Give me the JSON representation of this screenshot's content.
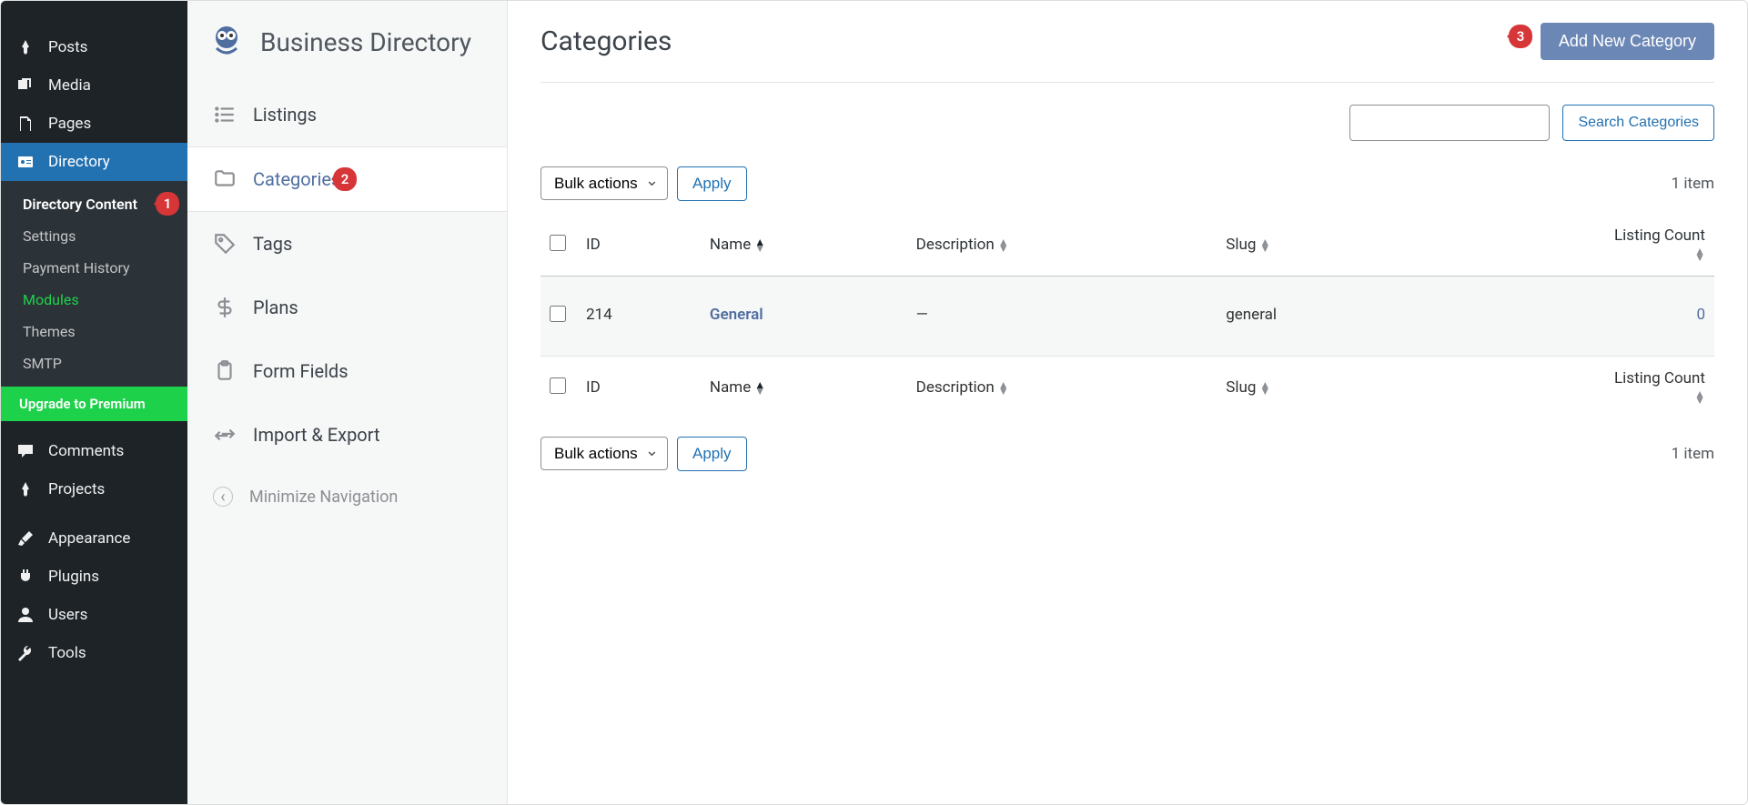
{
  "wp_sidebar": {
    "items": [
      {
        "label": "Posts",
        "icon": "pin"
      },
      {
        "label": "Media",
        "icon": "media"
      },
      {
        "label": "Pages",
        "icon": "pages"
      },
      {
        "label": "Directory",
        "icon": "card",
        "active": true
      },
      {
        "label": "Comments",
        "icon": "comment"
      },
      {
        "label": "Projects",
        "icon": "pin"
      },
      {
        "label": "Appearance",
        "icon": "brush"
      },
      {
        "label": "Plugins",
        "icon": "plug"
      },
      {
        "label": "Users",
        "icon": "user"
      },
      {
        "label": "Tools",
        "icon": "wrench"
      }
    ],
    "sub": [
      {
        "label": "Directory Content",
        "bold": true
      },
      {
        "label": "Settings"
      },
      {
        "label": "Payment History"
      },
      {
        "label": "Modules",
        "green": true
      },
      {
        "label": "Themes"
      },
      {
        "label": "SMTP"
      }
    ],
    "upgrade": "Upgrade to Premium"
  },
  "bd_sidebar": {
    "title": "Business Directory",
    "items": [
      {
        "label": "Listings",
        "icon": "list"
      },
      {
        "label": "Categories",
        "icon": "folder",
        "active": true
      },
      {
        "label": "Tags",
        "icon": "tag"
      },
      {
        "label": "Plans",
        "icon": "dollar"
      },
      {
        "label": "Form Fields",
        "icon": "clipboard"
      },
      {
        "label": "Import & Export",
        "icon": "transfer"
      }
    ],
    "minimize": "Minimize Navigation"
  },
  "main": {
    "title": "Categories",
    "add_button": "Add New Category",
    "search_button": "Search Categories",
    "bulk_label": "Bulk actions",
    "apply_label": "Apply",
    "items_count": "1 item",
    "columns": {
      "id": "ID",
      "name": "Name",
      "description": "Description",
      "slug": "Slug",
      "listing_count": "Listing Count"
    },
    "rows": [
      {
        "id": "214",
        "name": "General",
        "description": "—",
        "slug": "general",
        "count": "0"
      }
    ]
  },
  "badges": {
    "b1": "1",
    "b2": "2",
    "b3": "3"
  }
}
